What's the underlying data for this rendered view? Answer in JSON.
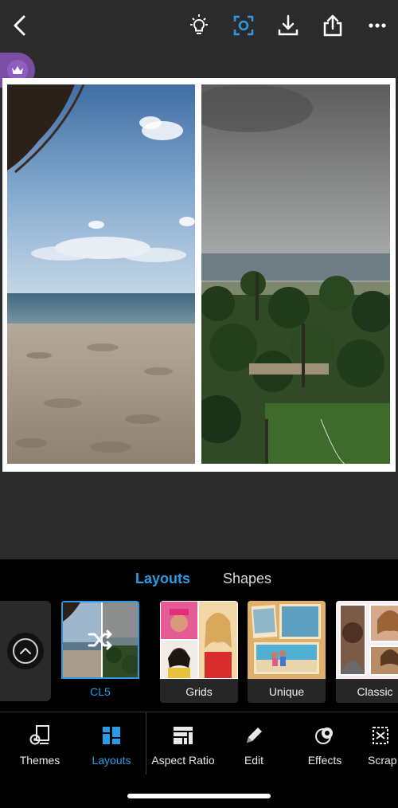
{
  "toolbar": {
    "icons": [
      "back-chevron-icon",
      "lightbulb-icon",
      "focus-frame-icon",
      "download-icon",
      "share-icon",
      "more-icon"
    ]
  },
  "premium": {
    "icon": "crown-icon"
  },
  "canvas": {
    "photos": [
      {
        "scene": "beach-sand-sea-sky"
      },
      {
        "scene": "palm-trees-sea-cloudy"
      }
    ]
  },
  "segments": {
    "layouts_label": "Layouts",
    "shapes_label": "Shapes"
  },
  "tray": {
    "cards": [
      {
        "label": "CL5",
        "selected": true
      },
      {
        "label": "Grids",
        "selected": false
      },
      {
        "label": "Unique",
        "selected": false
      },
      {
        "label": "Classic",
        "selected": false
      }
    ]
  },
  "nav": {
    "items": [
      {
        "label": "Themes",
        "icon": "themes-icon"
      },
      {
        "label": "Layouts",
        "icon": "layouts-icon",
        "active": true
      },
      {
        "label": "Aspect Ratio",
        "icon": "aspect-ratio-icon"
      },
      {
        "label": "Edit",
        "icon": "pencil-icon"
      },
      {
        "label": "Effects",
        "icon": "effects-icon"
      },
      {
        "label": "Scrap",
        "icon": "scrapbook-icon"
      }
    ]
  },
  "colors": {
    "accent": "#2c9be6",
    "background": "#2b2b2b",
    "panel": "#000000"
  }
}
